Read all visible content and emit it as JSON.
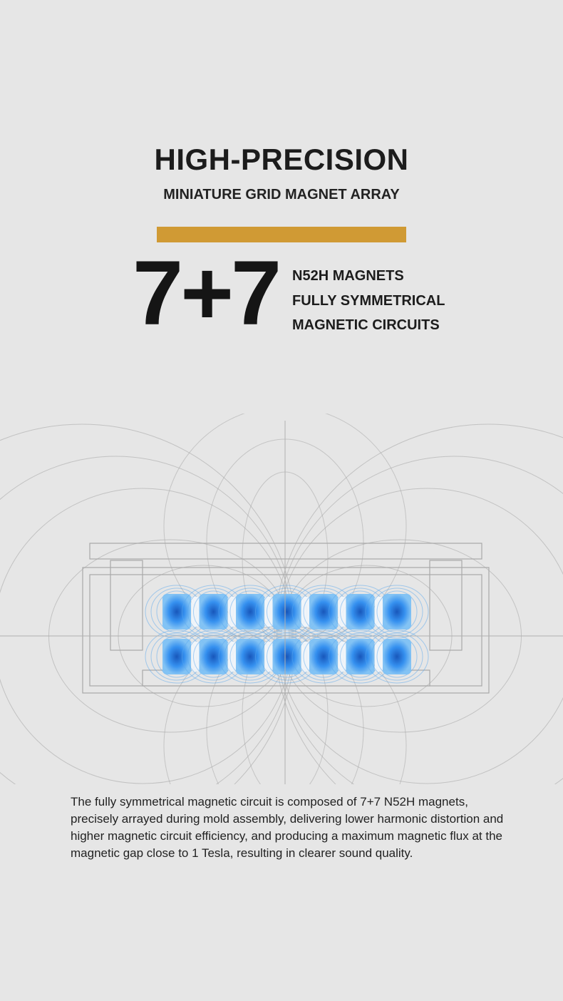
{
  "header": {
    "title": "HIGH-PRECISION",
    "subtitle": "MINIATURE GRID MAGNET ARRAY"
  },
  "highlight": {
    "number": "7+7",
    "features": [
      "N52H MAGNETS",
      "FULLY SYMMETRICAL",
      "MAGNETIC CIRCUITS"
    ]
  },
  "description": "The fully symmetrical magnetic circuit is composed of 7+7 N52H magnets, precisely arrayed during mold assembly, delivering lower harmonic distortion and higher magnetic circuit efficiency, and producing a maximum magnetic flux at the magnetic gap close to 1 Tesla, resulting in clearer sound quality.",
  "colors": {
    "background": "#e6e6e6",
    "accent": "#d09a34",
    "magnet": "#1f7ee0",
    "field_line": "#9a9a9a"
  },
  "diagram": {
    "icon": "magnet-array-field-diagram",
    "magnet_rows": 2,
    "magnets_per_row": 7
  }
}
